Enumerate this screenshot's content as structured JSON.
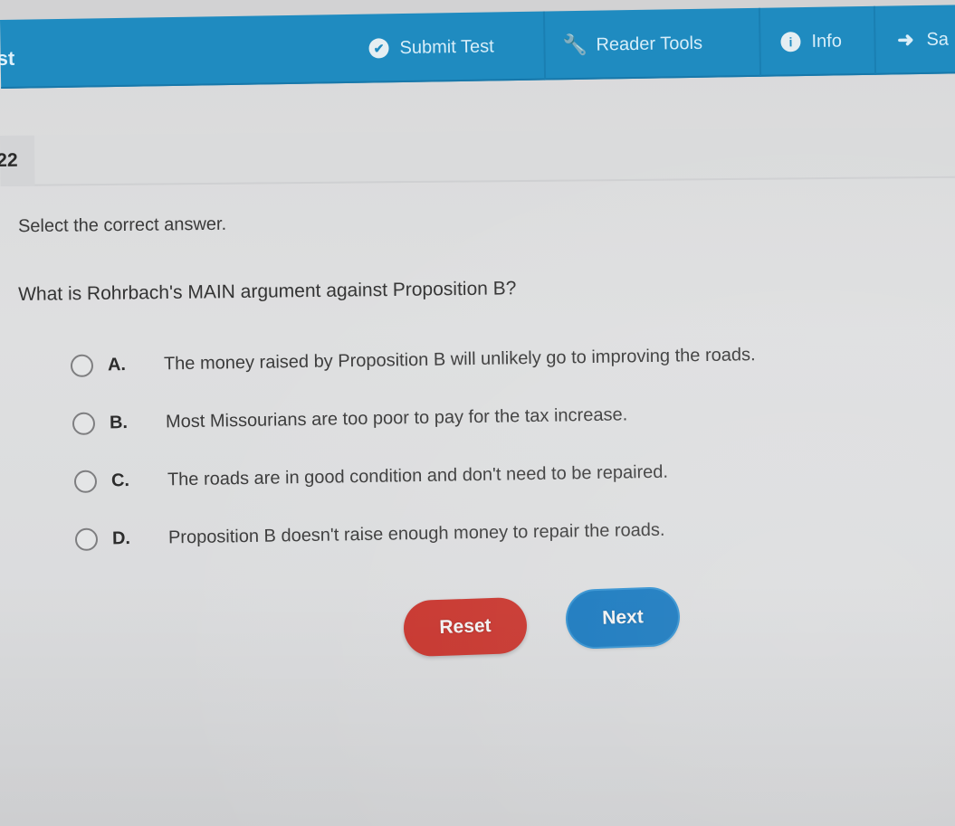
{
  "toolbar": {
    "title_fragment": "st",
    "items": [
      {
        "label": "Submit Test",
        "icon": "check-circle-icon"
      },
      {
        "label": "Reader Tools",
        "icon": "wrench-icon"
      },
      {
        "label": "Info",
        "icon": "info-circle-icon"
      },
      {
        "label": "Sa",
        "icon": "sign-out-icon"
      }
    ]
  },
  "question": {
    "number": "22",
    "instruction": "Select the correct answer.",
    "prompt": "What is Rohrbach's MAIN argument against Proposition B?",
    "options": [
      {
        "letter": "A.",
        "text": "The money raised by Proposition B will unlikely go to improving the roads.",
        "selected": false
      },
      {
        "letter": "B.",
        "text": "Most Missourians are too poor to pay for the tax increase.",
        "selected": false
      },
      {
        "letter": "C.",
        "text": "The roads are in good condition and don't need to be repaired.",
        "selected": false
      },
      {
        "letter": "D.",
        "text": "Proposition B doesn't raise enough money to repair the roads.",
        "selected": false
      }
    ]
  },
  "buttons": {
    "reset_label": "Reset",
    "next_label": "Next"
  },
  "colors": {
    "toolbar": "#1f8bc0",
    "reset": "#c8322a",
    "next": "#1376be"
  }
}
